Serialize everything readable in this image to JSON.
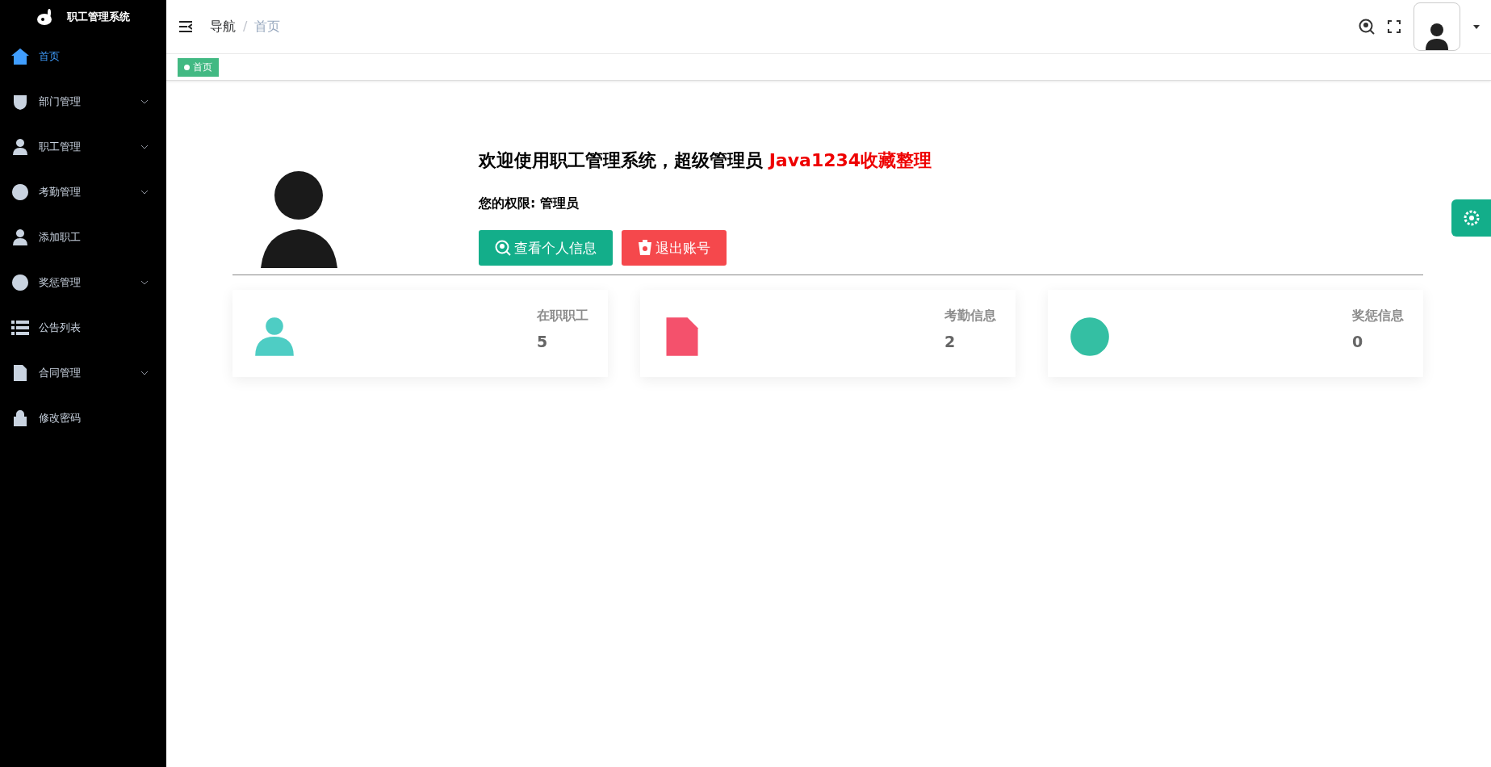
{
  "sidebar": {
    "title": "职工管理系统",
    "items": [
      {
        "label": "首页",
        "selected": true,
        "expandable": false
      },
      {
        "label": "部门管理",
        "selected": false,
        "expandable": true
      },
      {
        "label": "职工管理",
        "selected": false,
        "expandable": true
      },
      {
        "label": "考勤管理",
        "selected": false,
        "expandable": true
      },
      {
        "label": "添加职工",
        "selected": false,
        "expandable": false
      },
      {
        "label": "奖惩管理",
        "selected": false,
        "expandable": true
      },
      {
        "label": "公告列表",
        "selected": false,
        "expandable": false
      },
      {
        "label": "合同管理",
        "selected": false,
        "expandable": true
      },
      {
        "label": "修改密码",
        "selected": false,
        "expandable": false
      }
    ]
  },
  "breadcrumb": [
    "导航",
    "首页"
  ],
  "breadcrumb_separator": "/",
  "tags": [
    {
      "label": "首页",
      "selected": true
    }
  ],
  "welcome": {
    "text": "欢迎使用职工管理系统，超级管理员",
    "highlight": "Java1234收藏整理",
    "permission": "您的权限: 管理员",
    "buttons": [
      {
        "label": "查看个人信息",
        "kind": "info"
      },
      {
        "label": "退出账号",
        "kind": "logout"
      }
    ]
  },
  "stats": [
    {
      "label": "在职职工",
      "value": "5",
      "color": "#4ecdc4"
    },
    {
      "label": "考勤信息",
      "value": "2",
      "color": "#f4516c"
    },
    {
      "label": "奖惩信息",
      "value": "0",
      "color": "#34bfa3"
    }
  ]
}
